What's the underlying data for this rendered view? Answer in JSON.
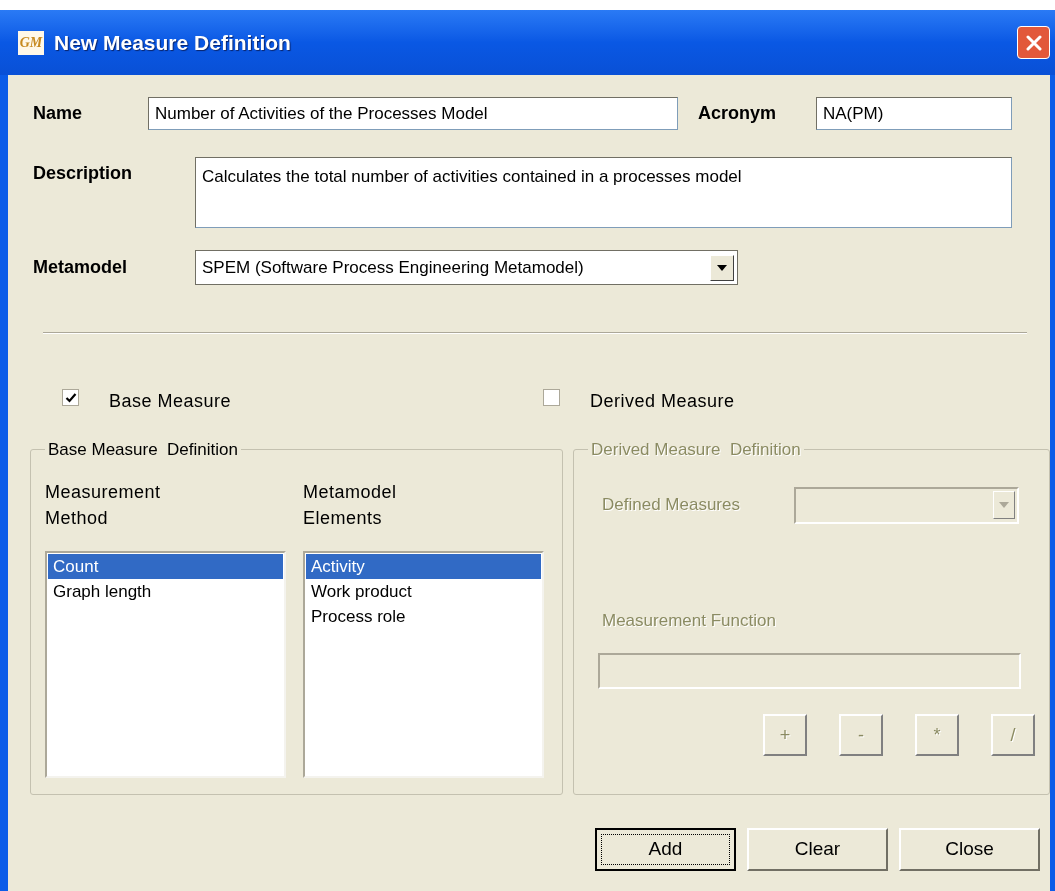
{
  "window": {
    "title": "New Measure Definition",
    "icon_text": "GM"
  },
  "name": {
    "label": "Name",
    "value": "Number of Activities of the Processes Model"
  },
  "acronym": {
    "label": "Acronym",
    "value": "NA(PM)"
  },
  "description": {
    "label": "Description",
    "value": "Calculates the total number of activities contained in a processes model"
  },
  "metamodel": {
    "label": "Metamodel",
    "value": "SPEM (Software Process Engineering Metamodel)"
  },
  "measure_types": [
    {
      "label": "Base Measure",
      "checked": true
    },
    {
      "label": "Derived Measure",
      "checked": false
    }
  ],
  "base_definition": {
    "title": "Base Measure  Definition",
    "disabled": false,
    "lists": [
      {
        "heading": "Measurement Method",
        "items": [
          {
            "label": "Count",
            "selected": true
          },
          {
            "label": "Graph length",
            "selected": false
          }
        ]
      },
      {
        "heading": "Metamodel Elements",
        "items": [
          {
            "label": "Activity",
            "selected": true
          },
          {
            "label": "Work product",
            "selected": false
          },
          {
            "label": "Process role",
            "selected": false
          }
        ]
      }
    ]
  },
  "derived_definition": {
    "title": "Derived Measure  Definition",
    "disabled": true,
    "defined_measures_label": "Defined Measures",
    "function_label": "Measurement Function",
    "operators": [
      "+",
      "-",
      "*",
      "/"
    ]
  },
  "buttons": [
    {
      "label": "Add",
      "focused": true
    },
    {
      "label": "Clear",
      "focused": false
    },
    {
      "label": "Close",
      "focused": false
    }
  ]
}
